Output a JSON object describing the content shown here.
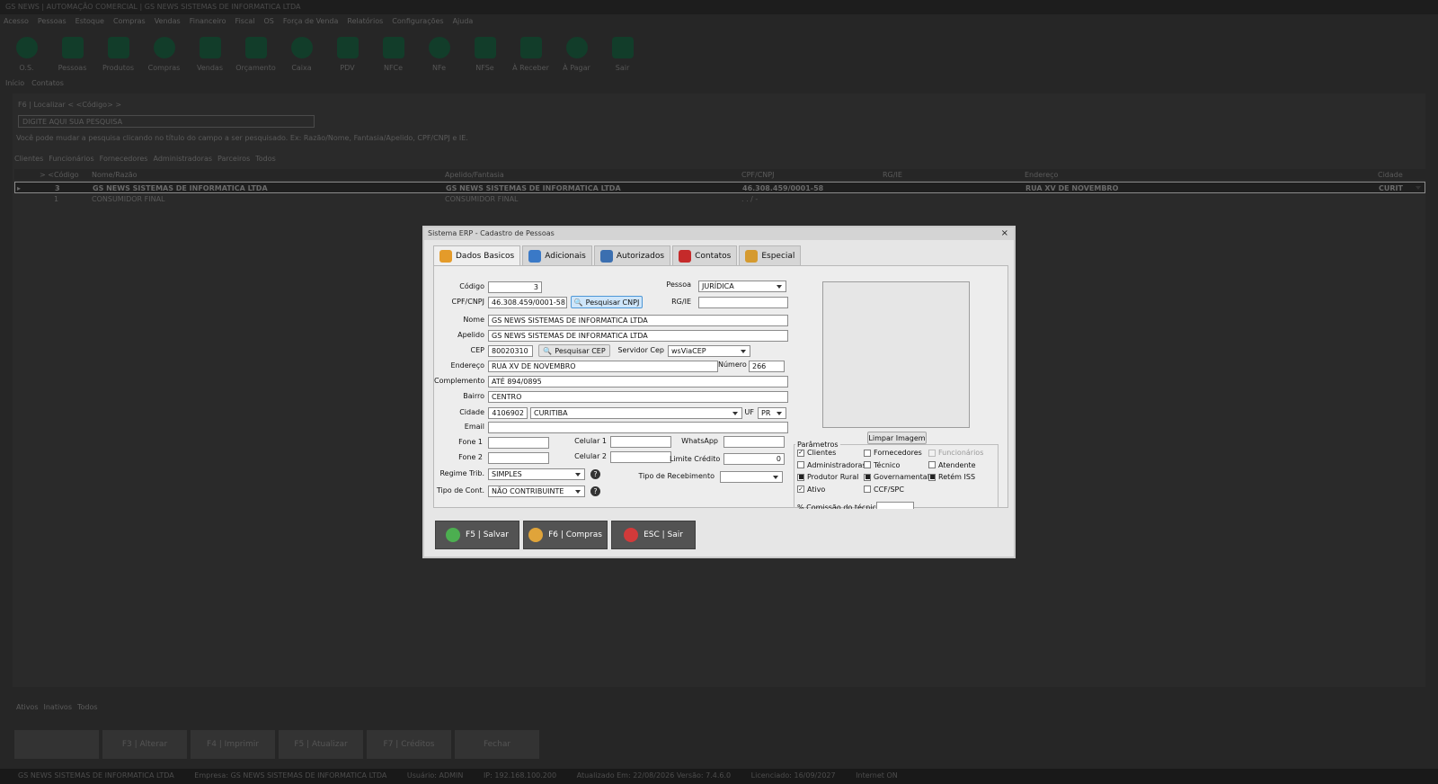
{
  "app": {
    "window_title": "GS NEWS | AUTOMAÇÃO COMERCIAL | GS NEWS SISTEMAS DE INFORMATICA LTDA",
    "menu": [
      "Acesso",
      "Pessoas",
      "Estoque",
      "Compras",
      "Vendas",
      "Financeiro",
      "Fiscal",
      "OS",
      "Força de Venda",
      "Relatórios",
      "Configurações",
      "Ajuda"
    ],
    "toolbar": [
      {
        "label": "O.S.",
        "icon": "clipboard-icon"
      },
      {
        "label": "Pessoas",
        "icon": "people-icon"
      },
      {
        "label": "Produtos",
        "icon": "box-icon"
      },
      {
        "label": "Compras",
        "icon": "cart-icon"
      },
      {
        "label": "Vendas",
        "icon": "sales-icon"
      },
      {
        "label": "Orçamento",
        "icon": "budget-icon"
      },
      {
        "label": "Caixa",
        "icon": "cashier-icon"
      },
      {
        "label": "PDV",
        "icon": "pos-icon"
      },
      {
        "label": "NFCe",
        "icon": "nfce-icon"
      },
      {
        "label": "NFe",
        "icon": "nfe-icon"
      },
      {
        "label": "NFSe",
        "icon": "nfse-icon"
      },
      {
        "label": "À Receber",
        "icon": "receivable-icon"
      },
      {
        "label": "À Pagar",
        "icon": "payable-icon"
      },
      {
        "label": "Sair",
        "icon": "exit-icon"
      }
    ],
    "page_tabs": [
      "Início",
      "Contatos"
    ],
    "search": {
      "label": "F6 | Localizar < <Código> >",
      "placeholder": "DIGITE AQUI SUA PESQUISA",
      "hint": "Você pode mudar a pesquisa clicando no título do campo a ser pesquisado. Ex: Razão/Nome, Fantasia/Apelido, CPF/CNPJ e IE."
    },
    "category_tabs": [
      "Clientes",
      "Funcionários",
      "Fornecedores",
      "Administradoras",
      "Parceiros",
      "Todos"
    ],
    "grid": {
      "columns": [
        "> <Código",
        "Nome/Razão",
        "Apelido/Fantasia",
        "CPF/CNPJ",
        "RG/IE",
        "Endereço",
        "Cidade"
      ],
      "rows": [
        {
          "marker": "▸",
          "codigo": "3",
          "nome": "GS NEWS SISTEMAS DE INFORMATICA LTDA",
          "apelido": "GS NEWS SISTEMAS DE INFORMATICA LTDA",
          "cpf": "46.308.459/0001-58",
          "rg": "",
          "endereco": "RUA XV DE NOVEMBRO",
          "cidade": "CURIT"
        },
        {
          "marker": "",
          "codigo": "1",
          "nome": "CONSUMIDOR FINAL",
          "apelido": "CONSUMIDOR FINAL",
          "cpf": ". . / -",
          "rg": "",
          "endereco": "",
          "cidade": ""
        }
      ]
    },
    "status_tabs": [
      "Ativos",
      "Inativos",
      "Todos"
    ],
    "bottom_buttons": [
      "",
      "F3 | Alterar",
      "F4 | Imprimir",
      "F5 | Atualizar",
      "F7 | Créditos",
      "Fechar"
    ],
    "statusbar": {
      "empresa_short": "GS NEWS SISTEMAS DE INFORMATICA LTDA",
      "empresa": "Empresa: GS NEWS SISTEMAS DE INFORMATICA LTDA",
      "usuario": "Usuário: ADMIN",
      "ip": "IP: 192.168.100.200",
      "atualizado": "Atualizado Em: 22/08/2026  Versão: 7.4.6.0",
      "licenciado": "Licenciado: 16/09/2027",
      "internet": "Internet ON"
    }
  },
  "dialog": {
    "title": "Sistema ERP - Cadastro de Pessoas",
    "close": "×",
    "tabs": [
      {
        "label": "Dados Basicos",
        "icon": "user-icon",
        "color": "#e49b2a"
      },
      {
        "label": "Adicionais",
        "icon": "clipboard-icon",
        "color": "#3a79c7"
      },
      {
        "label": "Autorizados",
        "icon": "id-card-icon",
        "color": "#3b6fb0"
      },
      {
        "label": "Contatos",
        "icon": "phone-icon",
        "color": "#c52a2a"
      },
      {
        "label": "Especial",
        "icon": "tools-icon",
        "color": "#d59a2f"
      }
    ],
    "fields": {
      "codigo_label": "Código",
      "codigo": "3",
      "pessoa_label": "Pessoa",
      "pessoa": "JURÍDICA",
      "cpf_label": "CPF/CNPJ",
      "cpf": "46.308.459/0001-58",
      "pesquisar_cnpj": "Pesquisar CNPJ",
      "rg_label": "RG/IE",
      "rg": "",
      "nome_label": "Nome",
      "nome": "GS NEWS SISTEMAS DE INFORMATICA LTDA",
      "apelido_label": "Apelido",
      "apelido": "GS NEWS SISTEMAS DE INFORMATICA LTDA",
      "cep_label": "CEP",
      "cep": "80020310",
      "pesquisar_cep": "Pesquisar CEP",
      "servidor_label": "Servidor Cep",
      "servidor": "wsViaCEP",
      "endereco_label": "Endereço",
      "endereco": "RUA XV DE NOVEMBRO",
      "numero_label": "Número",
      "numero": "266",
      "complemento_label": "Complemento",
      "complemento": "ATÉ 894/0895",
      "bairro_label": "Bairro",
      "bairro": "CENTRO",
      "cidade_label": "Cidade",
      "cidade_codigo": "4106902",
      "cidade": "CURITIBA",
      "uf_label": "UF",
      "uf": "PR",
      "email_label": "Email",
      "email": "",
      "fone1_label": "Fone 1",
      "fone1": "",
      "fone2_label": "Fone 2",
      "fone2": "",
      "celular1_label": "Celular 1",
      "celular1": "",
      "celular2_label": "Celular 2",
      "celular2": "",
      "whatsapp_label": "WhatsApp",
      "whatsapp": "",
      "limite_label": "Limite Crédito",
      "limite": "0",
      "regime_label": "Regime Trib.",
      "regime": "SIMPLES",
      "tipo_receb_label": "Tipo de Recebimento",
      "tipo_receb": "",
      "tipo_cont_label": "Tipo de Cont.",
      "tipo_cont": "NÃO CONTRIBUINTE",
      "limpar_imagem": "Limpar Imagem"
    },
    "params": {
      "title": "Parâmetros",
      "items": [
        {
          "label": "Clientes",
          "state": "check",
          "disabled": false
        },
        {
          "label": "Fornecedores",
          "state": "none",
          "disabled": false
        },
        {
          "label": "Funcionários",
          "state": "none",
          "disabled": true
        },
        {
          "label": "Administradoras",
          "state": "none",
          "disabled": false
        },
        {
          "label": "Técnico",
          "state": "none",
          "disabled": false
        },
        {
          "label": "Atendente",
          "state": "none",
          "disabled": false
        },
        {
          "label": "Produtor Rural",
          "state": "dot",
          "disabled": false
        },
        {
          "label": "Governamental",
          "state": "dot",
          "disabled": false
        },
        {
          "label": "Retém ISS",
          "state": "dot",
          "disabled": false
        },
        {
          "label": "Ativo",
          "state": "check",
          "disabled": false
        },
        {
          "label": "CCF/SPC",
          "state": "none",
          "disabled": false
        }
      ],
      "comissao_label": "% Comissão do técnico"
    },
    "actions": [
      {
        "label": "F5 | Salvar",
        "icon": "check-icon",
        "color": "#4caf50"
      },
      {
        "label": "F6 | Compras",
        "icon": "package-icon",
        "color": "#e0a43a"
      },
      {
        "label": "ESC | Sair",
        "icon": "cancel-icon",
        "color": "#d23a3a"
      }
    ]
  }
}
